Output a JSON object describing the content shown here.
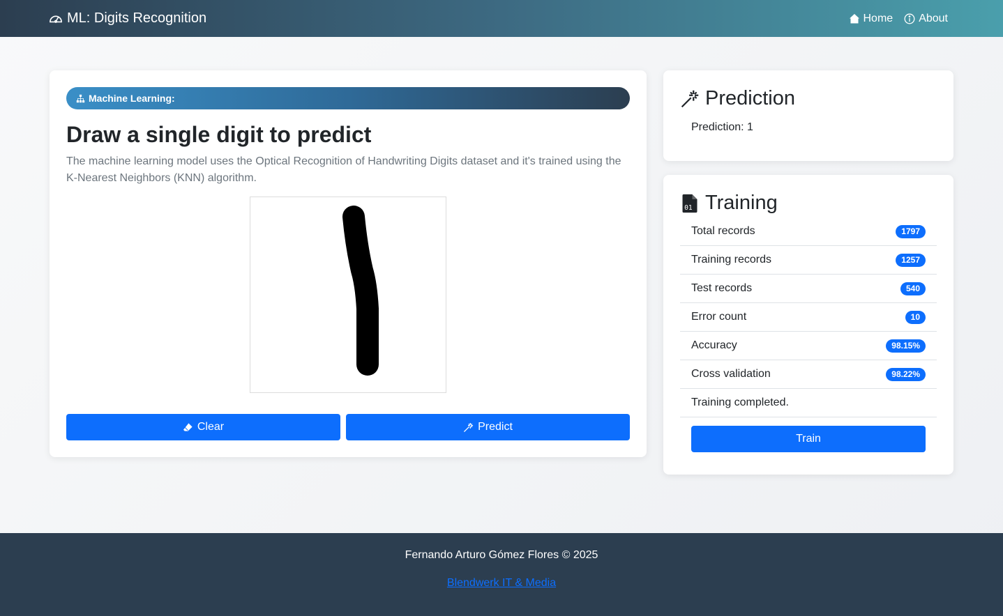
{
  "navbar": {
    "brand": "ML: Digits Recognition",
    "links": [
      {
        "label": "Home",
        "icon": "house-icon"
      },
      {
        "label": "About",
        "icon": "info-circle-icon"
      }
    ]
  },
  "main": {
    "badge": "Machine Learning:",
    "title": "Draw a single digit to predict",
    "description": "The machine learning model uses the Optical Recognition of Handwriting Digits dataset and it's trained using the K-Nearest Neighbors (KNN) algorithm.",
    "clear_label": "Clear",
    "predict_label": "Predict"
  },
  "prediction": {
    "title": "Prediction",
    "text": "Prediction: 1"
  },
  "training": {
    "title": "Training",
    "rows": [
      {
        "label": "Total records",
        "value": "1797"
      },
      {
        "label": "Training records",
        "value": "1257"
      },
      {
        "label": "Test records",
        "value": "540"
      },
      {
        "label": "Error count",
        "value": "10"
      },
      {
        "label": "Accuracy",
        "value": "98.15%"
      },
      {
        "label": "Cross validation",
        "value": "98.22%"
      }
    ],
    "status": "Training completed.",
    "train_label": "Train"
  },
  "footer": {
    "copyright": "Fernando Arturo Gómez Flores © 2025",
    "link": "Blendwerk IT & Media"
  },
  "colors": {
    "primary": "#0d6efd",
    "navbar_start": "#2c3e50",
    "navbar_end": "#4a9fac",
    "footer_bg": "#2c3e50"
  }
}
